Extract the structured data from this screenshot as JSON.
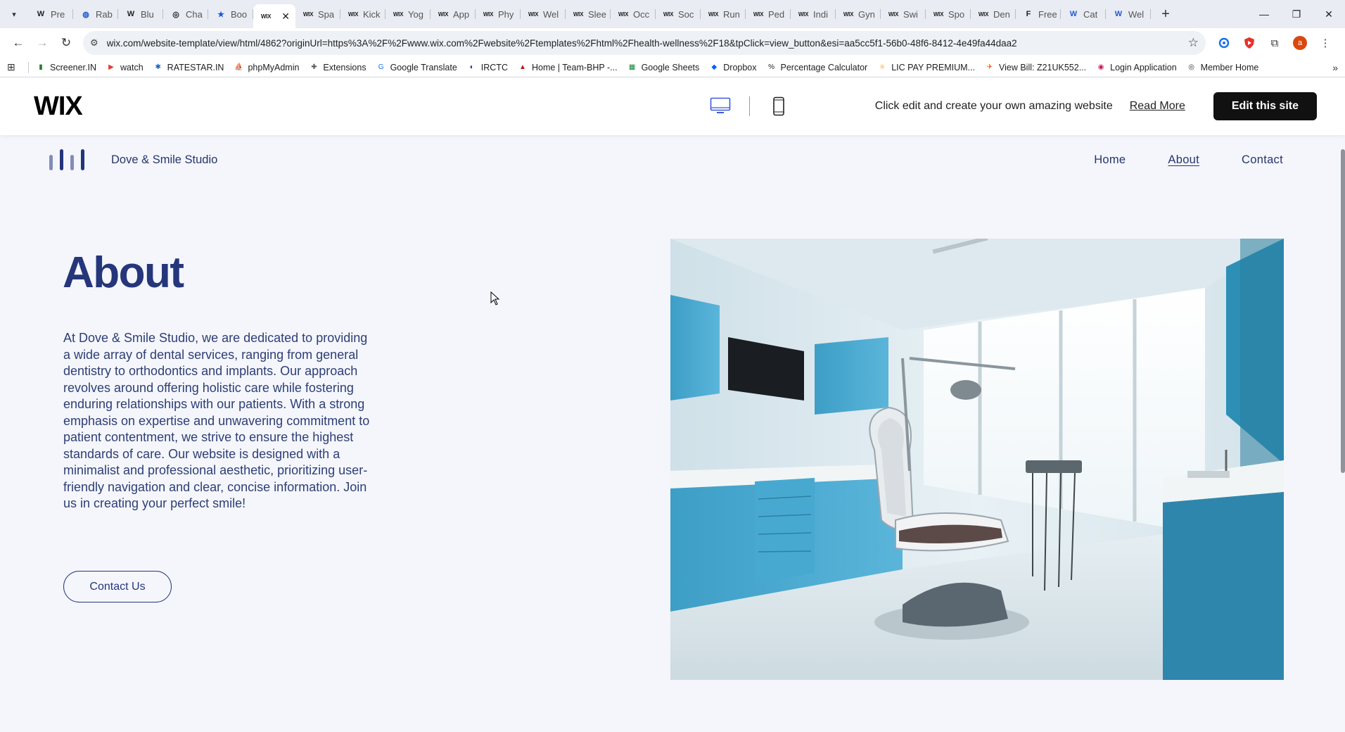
{
  "browser": {
    "tabs": [
      {
        "icon": "W",
        "label": "Pre",
        "fav_type": "w"
      },
      {
        "icon": "◍",
        "label": "Rab",
        "fav_type": "blue"
      },
      {
        "icon": "W",
        "label": "Blu",
        "fav_type": "w"
      },
      {
        "icon": "◎",
        "label": "Cha",
        "fav_type": "w"
      },
      {
        "icon": "★",
        "label": "Boo",
        "fav_type": "blue"
      },
      {
        "icon": "WIX",
        "label": "",
        "fav_type": "wix",
        "active": true
      },
      {
        "icon": "WIX",
        "label": "Spa",
        "fav_type": "wix"
      },
      {
        "icon": "WIX",
        "label": "Kick",
        "fav_type": "wix"
      },
      {
        "icon": "WIX",
        "label": "Yog",
        "fav_type": "wix"
      },
      {
        "icon": "WIX",
        "label": "App",
        "fav_type": "wix"
      },
      {
        "icon": "WIX",
        "label": "Phy",
        "fav_type": "wix"
      },
      {
        "icon": "WIX",
        "label": "Wel",
        "fav_type": "wix"
      },
      {
        "icon": "WIX",
        "label": "Slee",
        "fav_type": "wix"
      },
      {
        "icon": "WIX",
        "label": "Occ",
        "fav_type": "wix"
      },
      {
        "icon": "WIX",
        "label": "Soc",
        "fav_type": "wix"
      },
      {
        "icon": "WIX",
        "label": "Run",
        "fav_type": "wix"
      },
      {
        "icon": "WIX",
        "label": "Ped",
        "fav_type": "wix"
      },
      {
        "icon": "WIX",
        "label": "Indi",
        "fav_type": "wix"
      },
      {
        "icon": "WIX",
        "label": "Gyn",
        "fav_type": "wix"
      },
      {
        "icon": "WIX",
        "label": "Swi",
        "fav_type": "wix"
      },
      {
        "icon": "WIX",
        "label": "Spo",
        "fav_type": "wix"
      },
      {
        "icon": "WIX",
        "label": "Den",
        "fav_type": "wix"
      },
      {
        "icon": "F",
        "label": "Free",
        "fav_type": "w"
      },
      {
        "icon": "W",
        "label": "Cat",
        "fav_type": "blue"
      },
      {
        "icon": "W",
        "label": "Wel",
        "fav_type": "blue"
      }
    ],
    "new_tab": "+",
    "url": "wix.com/website-template/view/html/4862?originUrl=https%3A%2F%2Fwww.wix.com%2Fwebsite%2Ftemplates%2Fhtml%2Fhealth-wellness%2F18&tpClick=view_button&esi=aa5cc5f1-56b0-48f6-8412-4e49fa44daa2",
    "profile_initial": "a",
    "bookmarks": [
      {
        "label": "Screener.IN",
        "color": "#2e7d32",
        "glyph": "▮"
      },
      {
        "label": "watch",
        "color": "#e53935",
        "glyph": "▶"
      },
      {
        "label": "RATESTAR.IN",
        "color": "#1565c0",
        "glyph": "✱"
      },
      {
        "label": "phpMyAdmin",
        "color": "#f9a825",
        "glyph": "⛵"
      },
      {
        "label": "Extensions",
        "color": "#555555",
        "glyph": "✚"
      },
      {
        "label": "Google Translate",
        "color": "#1a73e8",
        "glyph": "G"
      },
      {
        "label": "IRCTC",
        "color": "#1a237e",
        "glyph": "◐"
      },
      {
        "label": "Home | Team-BHP -...",
        "color": "#b71c1c",
        "glyph": "▲"
      },
      {
        "label": "Google Sheets",
        "color": "#188038",
        "glyph": "▦"
      },
      {
        "label": "Dropbox",
        "color": "#0061fe",
        "glyph": "◆"
      },
      {
        "label": "Percentage Calculator",
        "color": "#222222",
        "glyph": "%"
      },
      {
        "label": "LIC PAY PREMIUM...",
        "color": "#f9a825",
        "glyph": "≡"
      },
      {
        "label": "View Bill: Z21UK552...",
        "color": "#e65100",
        "glyph": "✈"
      },
      {
        "label": "Login Application",
        "color": "#c2185b",
        "glyph": "◉"
      },
      {
        "label": "Member Home",
        "color": "#333333",
        "glyph": "◎"
      }
    ]
  },
  "wixbar": {
    "logo": "WIX",
    "message": "Click edit and create your own amazing website",
    "read_more": "Read More",
    "edit_button": "Edit this site"
  },
  "site": {
    "brand_name": "Dove & Smile Studio",
    "nav": [
      {
        "label": "Home",
        "current": false
      },
      {
        "label": "About",
        "current": true
      },
      {
        "label": "Contact",
        "current": false
      }
    ],
    "title": "About",
    "body": "At Dove & Smile Studio, we are dedicated to providing a wide array of dental services, ranging from general dentistry to orthodontics and implants. Our approach revolves around offering holistic care while fostering enduring relationships with our patients. With a strong emphasis on expertise and unwavering commitment to patient contentment, we strive to ensure the highest standards of care. Our website is designed with a minimalist and professional aesthetic, prioritizing user-friendly navigation and clear, concise information. Join us in creating your perfect smile!",
    "cta": "Contact Us"
  },
  "colors": {
    "brand_navy": "#25367a",
    "site_bg": "#f4f6fc",
    "cabinet_blue": "#4ba8cf"
  }
}
